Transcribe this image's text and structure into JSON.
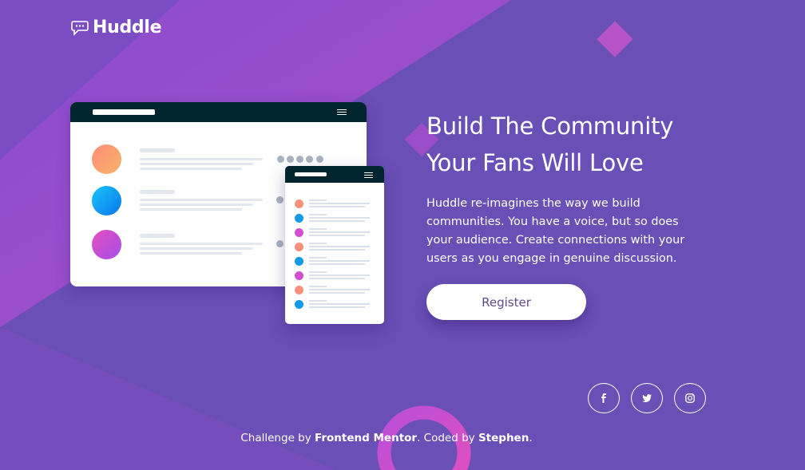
{
  "brand": {
    "name": "Huddle",
    "icon": "chat-bubble-icon"
  },
  "hero": {
    "title_line1": "Build The Community",
    "title_line2": "Your Fans Will Love",
    "description": "Huddle re-imagines the way we build communities. You have a voice, but so does your audience. Create connections with your users as you engage in genuine discussion.",
    "cta_label": "Register"
  },
  "social": [
    {
      "name": "facebook-icon",
      "glyph": "f"
    },
    {
      "name": "twitter-icon",
      "glyph": "🐦"
    },
    {
      "name": "instagram-icon",
      "glyph": "◎"
    }
  ],
  "footer": {
    "prefix": "Challenge by ",
    "mentor": "Frontend Mentor",
    "middle": ". Coded by ",
    "author": "Stephen",
    "suffix": "."
  },
  "colors": {
    "background": "#6852b4",
    "accent_pink": "#d94fc7",
    "button_text": "#5d4a8f",
    "mockup_bar": "#00252e"
  }
}
